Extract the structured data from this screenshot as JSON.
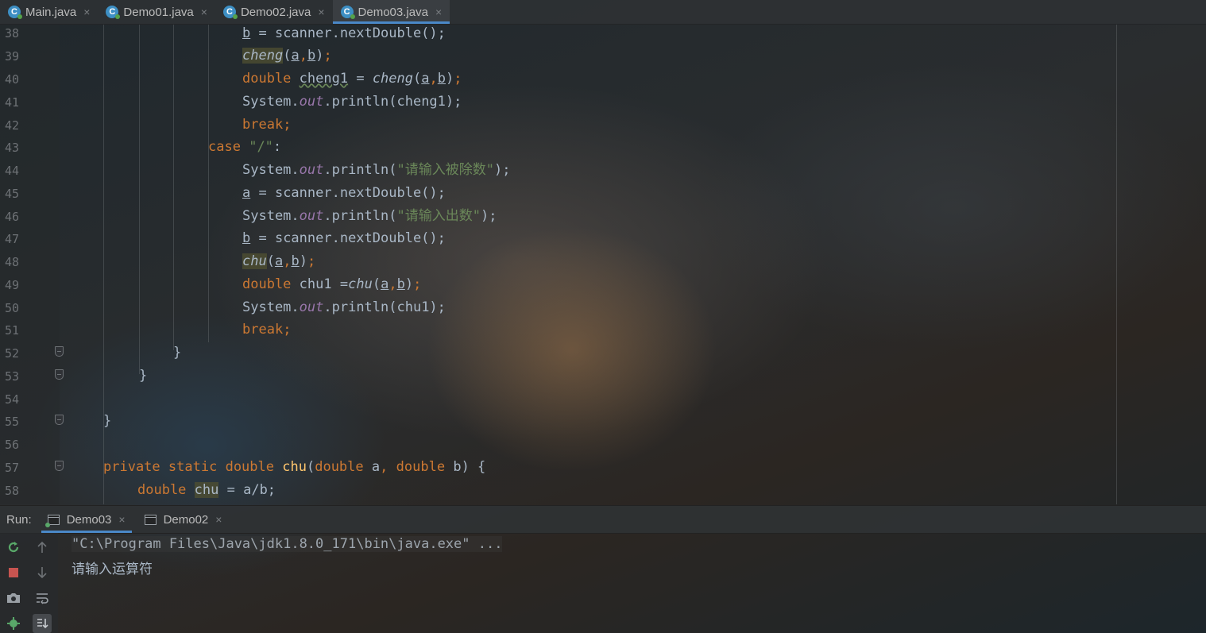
{
  "tabs": [
    {
      "label": "Main.java",
      "active": false
    },
    {
      "label": "Demo01.java",
      "active": false
    },
    {
      "label": "Demo02.java",
      "active": false
    },
    {
      "label": "Demo03.java",
      "active": true
    }
  ],
  "tab_icon_letter": "C",
  "close_glyph": "×",
  "line_numbers": [
    "38",
    "39",
    "40",
    "41",
    "42",
    "43",
    "44",
    "45",
    "46",
    "47",
    "48",
    "49",
    "50",
    "51",
    "52",
    "53",
    "54",
    "55",
    "56",
    "57",
    "58"
  ],
  "code": {
    "l38": {
      "b": "b",
      "rest": " = scanner.nextDouble();"
    },
    "l39": {
      "fn": "cheng",
      "a": "a",
      "b": "b"
    },
    "l40": {
      "kw": "double",
      "var": "cheng1",
      "eq": " = ",
      "fn": "cheng",
      "a": "a",
      "b": "b"
    },
    "l41": {
      "sys": "System.",
      "out": "out",
      "call": ".println(cheng1);"
    },
    "l42": {
      "kw": "break"
    },
    "l43": {
      "kw": "case",
      "str": "\"/\"",
      "colon": ":"
    },
    "l44": {
      "sys": "System.",
      "out": "out",
      "call": ".println(",
      "str": "\"请输入被除数\"",
      "end": ");"
    },
    "l45": {
      "a": "a",
      "rest": " = scanner.nextDouble();"
    },
    "l46": {
      "sys": "System.",
      "out": "out",
      "call": ".println(",
      "str": "\"请输入出数\"",
      "end": ");"
    },
    "l47": {
      "b": "b",
      "rest": " = scanner.nextDouble();"
    },
    "l48": {
      "fn": "chu",
      "a": "a",
      "b": "b"
    },
    "l49": {
      "kw": "double",
      "var": "chu1",
      "eq": " =",
      "fn": "chu",
      "a": "a",
      "b": "b"
    },
    "l50": {
      "sys": "System.",
      "out": "out",
      "call": ".println(chu1);"
    },
    "l51": {
      "kw": "break"
    },
    "l52": "}",
    "l53": "}",
    "l55": "}",
    "l57": {
      "kw1": "private",
      "kw2": "static",
      "kw3": "double",
      "name": "chu",
      "kwp1": "double",
      "p1": "a",
      "kwp2": "double",
      "p2": "b",
      "open": "{"
    },
    "l58": {
      "kw": "double",
      "var": "chu",
      "rest": " = a/b;"
    }
  },
  "run": {
    "label": "Run:",
    "tabs": [
      {
        "label": "Demo03",
        "active": true
      },
      {
        "label": "Demo02",
        "active": false
      }
    ]
  },
  "console": {
    "command": "\"C:\\Program Files\\Java\\jdk1.8.0_171\\bin\\java.exe\" ...",
    "output": "请输入运算符"
  },
  "colors": {
    "keyword": "#cc7832",
    "string": "#6a8759",
    "field": "#9876aa",
    "method_decl": "#ffc66d",
    "text": "#a9b7c6",
    "accent": "#4a88c7"
  }
}
